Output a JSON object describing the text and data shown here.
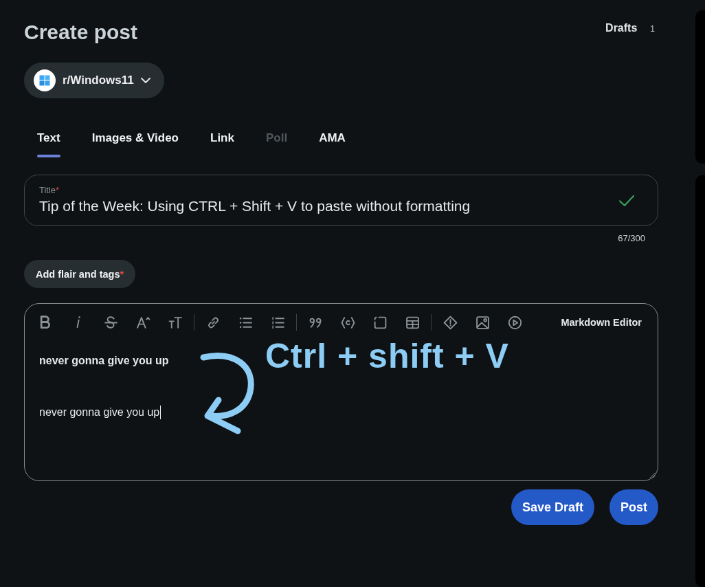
{
  "header": {
    "title": "Create post",
    "drafts": {
      "label": "Drafts",
      "count": "1"
    }
  },
  "community": {
    "name": "r/Windows11"
  },
  "tabs": [
    {
      "label": "Text",
      "selected": true,
      "disabled": false
    },
    {
      "label": "Images & Video",
      "selected": false,
      "disabled": false
    },
    {
      "label": "Link",
      "selected": false,
      "disabled": false
    },
    {
      "label": "Poll",
      "selected": false,
      "disabled": true
    },
    {
      "label": "AMA",
      "selected": false,
      "disabled": false
    }
  ],
  "title_field": {
    "label": "Title",
    "required_mark": "*",
    "value": "Tip of the Week: Using CTRL + Shift + V to paste without formatting",
    "valid": true,
    "counter": "67/300"
  },
  "flair_button": {
    "label": "Add flair and tags",
    "required_mark": "*"
  },
  "editor": {
    "mode_label": "Markdown Editor",
    "lines": [
      {
        "text": "never gonna give you up",
        "bold": true,
        "caret": false
      },
      {
        "text": "never gonna give you up",
        "bold": false,
        "caret": true
      }
    ]
  },
  "annotation": {
    "text": "Ctrl + shift + V"
  },
  "actions": [
    {
      "label": "Save Draft"
    },
    {
      "label": "Post"
    }
  ]
}
